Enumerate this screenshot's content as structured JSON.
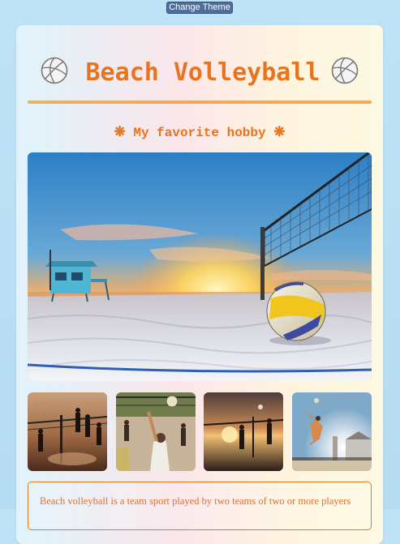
{
  "header": {
    "theme_button_label": "Change Theme"
  },
  "card": {
    "title": "Beach Volleyball",
    "subtitle_prefix": "❋",
    "subtitle": "My favorite hobby",
    "subtitle_suffix": "❋",
    "description": "Beach volleyball is a team sport played by two teams of two or more players"
  },
  "images": {
    "hero": "beach-volleyball-sunset-photo",
    "thumbnails": [
      "players-at-net-photo",
      "player-serving-photo",
      "sunset-game-photo",
      "player-spiking-photo"
    ]
  },
  "colors": {
    "accent": "#e8741e",
    "button": "#4f6f9a",
    "background": "#bfe2f6"
  }
}
